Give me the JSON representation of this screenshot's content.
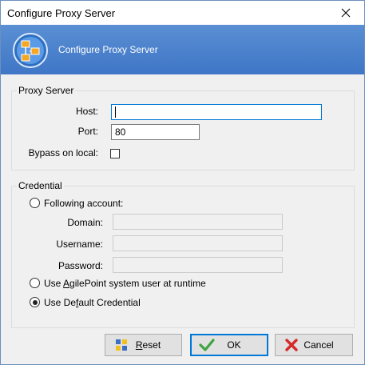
{
  "window": {
    "title": "Configure Proxy Server",
    "close_label": "✕"
  },
  "banner": {
    "title": "Configure Proxy Server"
  },
  "proxy": {
    "legend": "Proxy Server",
    "host_label": "Host:",
    "host_value": "",
    "port_label": "Port:",
    "port_value": "80",
    "bypass_label": "Bypass on local:",
    "bypass_checked": false
  },
  "credential": {
    "legend": "Credential",
    "following_label": "Following account:",
    "domain_label": "Domain:",
    "domain_value": "",
    "username_label": "Username:",
    "username_value": "",
    "password_label": "Password:",
    "password_value": "",
    "agilepoint_label_pre": "Use ",
    "agilepoint_label_ul": "A",
    "agilepoint_label_post": "gilePoint system user at runtime",
    "default_label_pre": "Use De",
    "default_label_ul": "f",
    "default_label_post": "ault Credential",
    "selected": "default"
  },
  "buttons": {
    "reset_ul": "R",
    "reset_rest": "eset",
    "ok": "OK",
    "cancel": "Cancel"
  },
  "colors": {
    "banner": "#4a83cc",
    "accent": "#0078d7"
  }
}
